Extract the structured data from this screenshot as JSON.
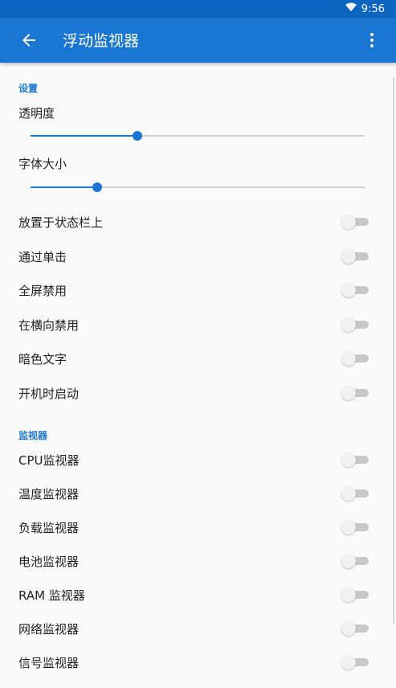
{
  "status_bar": {
    "time": "9:56",
    "wifi_icon": "wifi-icon"
  },
  "app_bar": {
    "title": "浮动监视器",
    "back_icon": "arrow-back-icon",
    "menu_icon": "more-vert-icon"
  },
  "settings_section": {
    "header": "设置",
    "transparency": {
      "label": "透明度",
      "value_fraction": 0.32
    },
    "font_size": {
      "label": "字体大小",
      "value_fraction": 0.2
    },
    "toggles": [
      {
        "label": "放置于状态栏上",
        "on": false
      },
      {
        "label": "通过单击",
        "on": false
      },
      {
        "label": "全屏禁用",
        "on": false
      },
      {
        "label": "在横向禁用",
        "on": false
      },
      {
        "label": "暗色文字",
        "on": false
      },
      {
        "label": "开机时启动",
        "on": false
      }
    ]
  },
  "monitor_section": {
    "header": "监视器",
    "toggles": [
      {
        "label": "CPU监视器",
        "on": false
      },
      {
        "label": "温度监视器",
        "on": false
      },
      {
        "label": "负载监视器",
        "on": false
      },
      {
        "label": "电池监视器",
        "on": false
      },
      {
        "label": "RAM 监视器",
        "on": false
      },
      {
        "label": "网络监视器",
        "on": false
      },
      {
        "label": "信号监视器",
        "on": false
      }
    ]
  },
  "colors": {
    "accent": "#1976d2",
    "status_bar": "#0d65c2",
    "background": "#fafafa"
  }
}
